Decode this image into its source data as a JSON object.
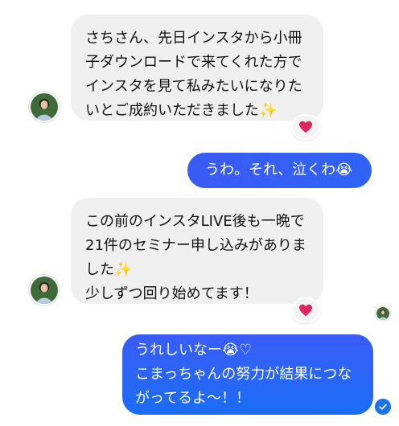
{
  "messages": [
    {
      "side": "incoming",
      "text": "さちさん、先日インスタから小冊\n子ダウンロードで来てくれた方で\nインスタを見て私みたいになりた\nいとご成約いただきました✨",
      "reaction": "red-heart-icon"
    },
    {
      "side": "outgoing",
      "text": "うわ。それ、泣くわ😭"
    },
    {
      "side": "incoming",
      "text": "この前のインスタLIVE後も一晩で\n21件のセミナー申し込みがありま\nした✨\n少しずつ回り始めてます！",
      "reaction": "red-heart-icon"
    },
    {
      "side": "outgoing",
      "text": "うれしいなー😭♡\nこまっちゃんの努力が結果につな\nがってるよ〜！！",
      "status": "seen-check-icon"
    }
  ],
  "colors": {
    "incoming_bubble": "#efefef",
    "outgoing_gradient_start": "#3b5bf6",
    "outgoing_gradient_end": "#1a6ef5",
    "heart": "#e0245e",
    "check": "#1a73e8"
  }
}
